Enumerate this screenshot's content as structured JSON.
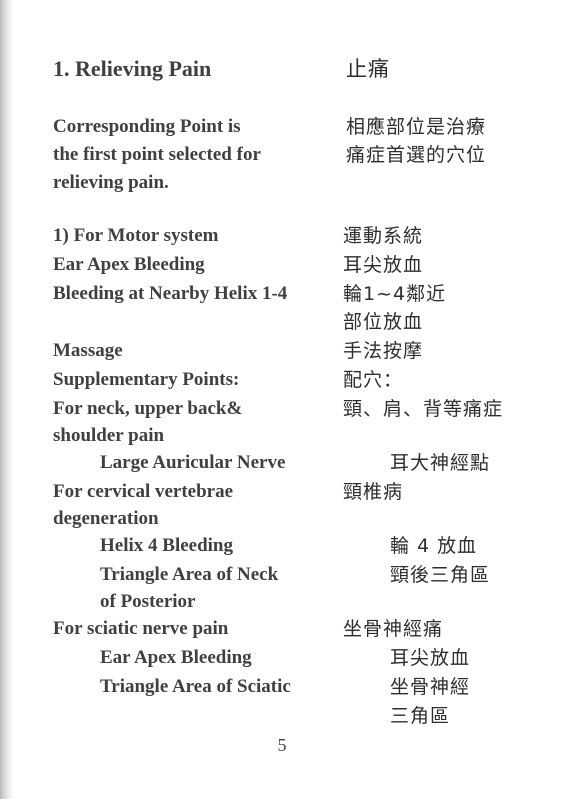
{
  "title": {
    "en": "1. Relieving Pain",
    "zh": "止痛"
  },
  "intro": {
    "en": [
      "Corresponding Point is",
      "the first point selected for",
      "relieving pain."
    ],
    "zh": [
      "相應部位是治療",
      "痛症首選的穴位"
    ]
  },
  "motor": {
    "heading": {
      "en": "1) For Motor system",
      "zh": "運動系統"
    },
    "apex": {
      "en": "Ear Apex Bleeding",
      "zh": "耳尖放血"
    },
    "helix": {
      "en": "Bleeding at Nearby Helix 1-4",
      "zh": [
        "輪1~4鄰近",
        "部位放血"
      ]
    },
    "massage": {
      "en": "Massage",
      "zh": "手法按摩"
    },
    "supp": {
      "en": "Supplementary Points:",
      "zh": "配穴："
    }
  },
  "neck": {
    "en": [
      "For neck, upper back&",
      "shoulder pain"
    ],
    "zh": "頸、肩、背等痛症",
    "item": {
      "en": "Large Auricular Nerve",
      "zh": "耳大神經點"
    }
  },
  "cervical": {
    "en": [
      "For cervical vertebrae",
      "degeneration"
    ],
    "zh": "頸椎病",
    "items": [
      {
        "en": "Helix 4 Bleeding",
        "zh": "輪 4 放血"
      },
      {
        "en": [
          "Triangle Area of Neck",
          "of Posterior"
        ],
        "zh": "頸後三角區"
      }
    ]
  },
  "sciatic": {
    "en": "For sciatic nerve pain",
    "zh": "坐骨神經痛",
    "items": [
      {
        "en": "Ear Apex Bleeding",
        "zh": "耳尖放血"
      },
      {
        "en": "Triangle Area of Sciatic",
        "zh": [
          "坐骨神經",
          "三角區"
        ]
      }
    ]
  },
  "page_number": "5"
}
